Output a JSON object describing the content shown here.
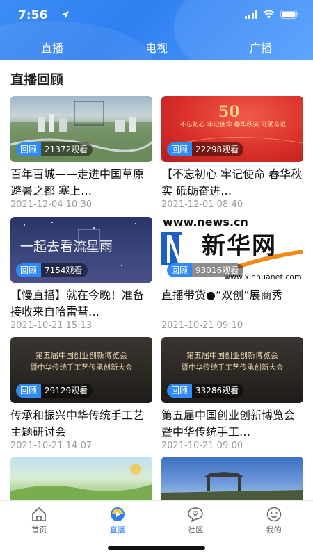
{
  "status_bar": {
    "time": "7:56"
  },
  "tabs": [
    {
      "label": "直播"
    },
    {
      "label": "电视"
    },
    {
      "label": "广播"
    }
  ],
  "section_title": "直播回顾",
  "badge_tag": "回顾",
  "cards": [
    {
      "views": "21372观看",
      "title": "百年百城——走进中国草原避暑之都 塞上…",
      "date": "2021-12-04 10:30"
    },
    {
      "views": "22298观看",
      "title": "【不忘初心 牢记使命 春华秋实 砥砺奋进…",
      "date": "2021-12-01 08:40"
    },
    {
      "views": "7154观看",
      "title": "【慢直播】就在今晚！准备接收来自哈雷彗…",
      "date": "2021-10-21 15:13"
    },
    {
      "views": "93016观看",
      "title": "直播带货●“双创”展商秀",
      "date": "2021-10-21 09:10"
    },
    {
      "views": "29129观看",
      "title": "传承和振兴中华传统手工艺主题研讨会",
      "date": "2021-10-21 14:07"
    },
    {
      "views": "33286观看",
      "title": "第五届中国创业创新博览会暨中华传统手工…",
      "date": "2021-10-21 09:00"
    }
  ],
  "thumb_texts": {
    "card2_banner": "不忘初心 牢记使命 春华秋实 砥砺奋进",
    "card3_main": "一起去看流星雨",
    "card4_url_top": "www.news.cn",
    "card4_logo": "新华网",
    "card4_url_bottom": "www.xinhuanet.com",
    "card5_line1": "第五届中国创业创新博览会",
    "card5_line2": "暨中华传统手工艺传承创新大会",
    "card6_line1": "第五届中国创业创新博览会",
    "card6_line2": "暨中华传统手工艺传承创新大会"
  },
  "bottom_nav": [
    {
      "label": "首页"
    },
    {
      "label": "直播"
    },
    {
      "label": "社区"
    },
    {
      "label": "我的"
    }
  ],
  "colors": {
    "accent": "#2f7ff0",
    "header": "#3d8df5",
    "badge": "#2f8af5"
  }
}
